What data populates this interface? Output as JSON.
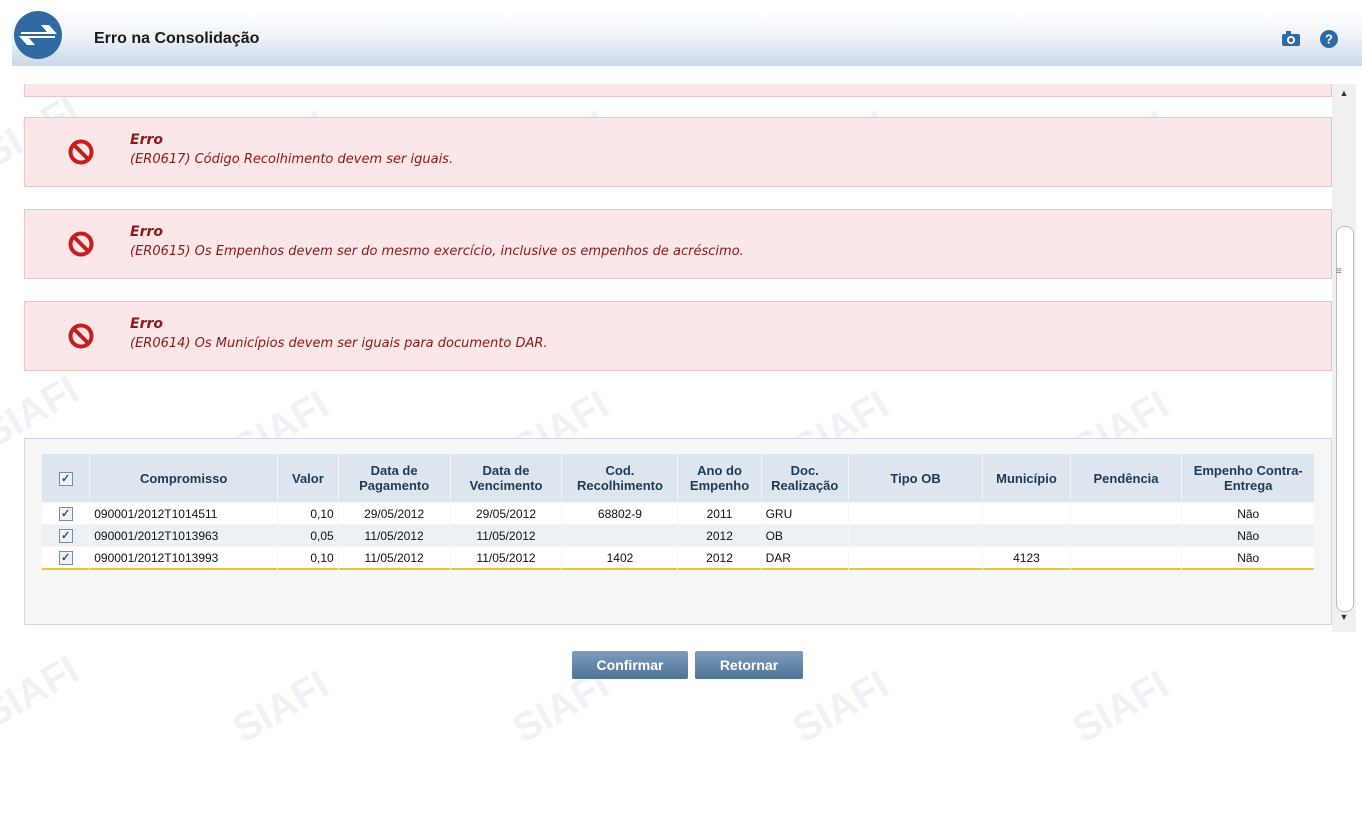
{
  "header": {
    "title": "Erro na Consolidação",
    "icons": [
      "camera-icon",
      "help-icon"
    ]
  },
  "watermark": "SIAFI",
  "errors": [
    {
      "heading": "Erro",
      "message": "(ER0617) Código Recolhimento devem ser iguais."
    },
    {
      "heading": "Erro",
      "message": "(ER0615) Os Empenhos devem ser do mesmo exercício, inclusive os empenhos de acréscimo."
    },
    {
      "heading": "Erro",
      "message": "(ER0614) Os Municípios devem ser iguais para documento DAR."
    }
  ],
  "table": {
    "columns": [
      "Compromisso",
      "Valor",
      "Data de Pagamento",
      "Data de Vencimento",
      "Cod. Recolhimento",
      "Ano do Empenho",
      "Doc. Realização",
      "Tipo OB",
      "Município",
      "Pendência",
      "Empenho Contra-Entrega"
    ],
    "rows": [
      {
        "checked": true,
        "compromisso": "090001/2012T1014511",
        "valor": "0,10",
        "data_pagamento": "29/05/2012",
        "data_vencimento": "29/05/2012",
        "cod_recolhimento": "68802-9",
        "ano_empenho": "2011",
        "doc_realizacao": "GRU",
        "tipo_ob": "",
        "municipio": "",
        "pendencia": "",
        "empenho_contra_entrega": "Não"
      },
      {
        "checked": true,
        "compromisso": "090001/2012T1013963",
        "valor": "0,05",
        "data_pagamento": "11/05/2012",
        "data_vencimento": "11/05/2012",
        "cod_recolhimento": "",
        "ano_empenho": "2012",
        "doc_realizacao": "OB",
        "tipo_ob": "",
        "municipio": "",
        "pendencia": "",
        "empenho_contra_entrega": "Não"
      },
      {
        "checked": true,
        "compromisso": "090001/2012T1013993",
        "valor": "0,10",
        "data_pagamento": "11/05/2012",
        "data_vencimento": "11/05/2012",
        "cod_recolhimento": "1402",
        "ano_empenho": "2012",
        "doc_realizacao": "DAR",
        "tipo_ob": "",
        "municipio": "4123",
        "pendencia": "",
        "empenho_contra_entrega": "Não"
      }
    ]
  },
  "buttons": {
    "confirm": "Confirmar",
    "back": "Retornar"
  },
  "colors": {
    "error_bg": "#fbe7e7",
    "error_text": "#8b1a1a",
    "button": "#5f83a6",
    "header_accent": "#3b6fa0"
  }
}
